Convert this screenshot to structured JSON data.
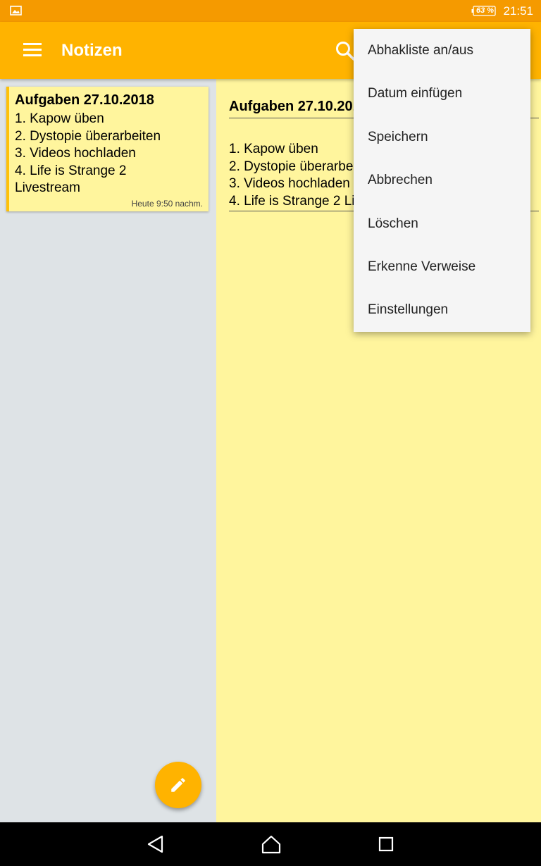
{
  "status_bar": {
    "battery_percent": "63 %",
    "time": "21:51",
    "notification_icon": "image-icon"
  },
  "app_bar": {
    "title": "Notizen",
    "menu_icon": "hamburger-menu-icon",
    "search_icon": "search-icon"
  },
  "note_list": [
    {
      "title": "Aufgaben 27.10.2018",
      "lines": [
        "1. Kapow üben",
        "2. Dystopie überarbeiten",
        "3. Videos hochladen",
        "4. Life is Strange 2",
        "Livestream"
      ],
      "timestamp": "Heute 9:50 nachm."
    }
  ],
  "detail": {
    "title": "Aufgaben 27.10.2018",
    "lines": [
      "1. Kapow üben",
      "2. Dystopie überarbeiten",
      "3. Videos hochladen",
      "4. Life is Strange 2 Livestream"
    ]
  },
  "overflow_menu": {
    "items": [
      "Abhakliste an/aus",
      "Datum einfügen",
      "Speichern",
      "Abbrechen",
      "Löschen",
      "Erkenne Verweise",
      "Einstellungen"
    ]
  },
  "fab": {
    "icon": "pencil-icon"
  },
  "nav_bar": {
    "back_icon": "back-icon",
    "home_icon": "home-icon",
    "recents_icon": "recents-icon"
  },
  "colors": {
    "status_bar": "#f59a00",
    "app_bar": "#ffb300",
    "note_background": "#fff59d",
    "list_background": "#dee3e6",
    "menu_background": "#f5f5f5"
  }
}
